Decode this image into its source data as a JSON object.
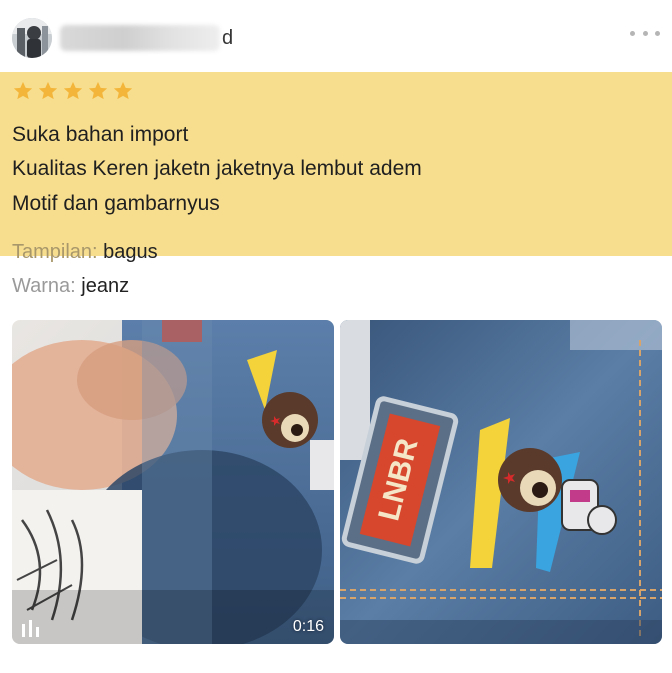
{
  "review": {
    "username_suffix": "d",
    "rating": 5,
    "rating_max": 5,
    "lines": [
      "Suka bahan import",
      "Kualitas Keren jaketn jaketnya lembut adem",
      "Motif dan gambarnyus"
    ],
    "attributes": [
      {
        "key": "Tampilan:",
        "value": "bagus"
      },
      {
        "key": "Warna:",
        "value": "jeanz"
      }
    ]
  },
  "media": {
    "video": {
      "duration": "0:16",
      "badge_icon": "video-bars-icon"
    },
    "photo": {
      "patch_text": "LNBR"
    }
  },
  "colors": {
    "highlight": "#f7de8f",
    "star": "#f4b63a",
    "muted_text": "#9a9a9a",
    "denim": "#4f6f97"
  },
  "icons": {
    "more": "more-dots-icon",
    "star": "star-icon"
  }
}
